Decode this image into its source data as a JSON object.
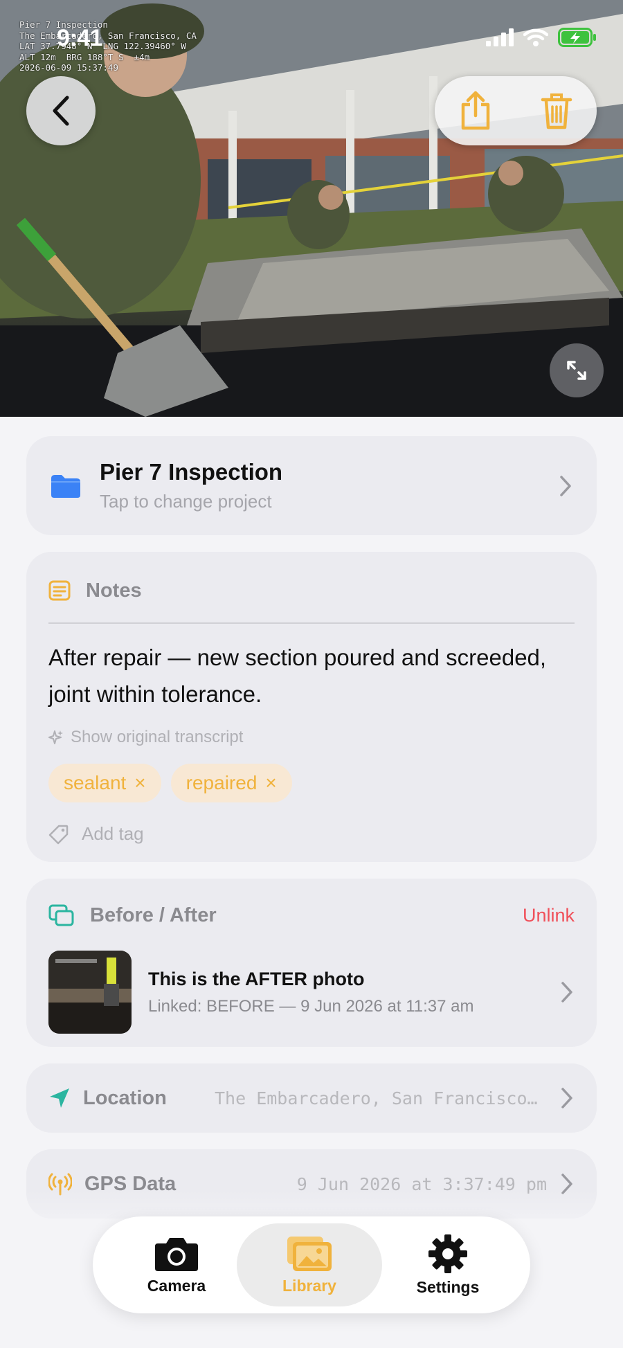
{
  "status_bar": {
    "time": "9:41"
  },
  "photo": {
    "overlay_lines": [
      "Pier 7 Inspection",
      "The Embarcadero, San Francisco, CA",
      "LAT 37.7948° N  LNG 122.39460° W",
      "ALT 12m  BRG 188°T S  ±4m",
      "2026-06-09 15:37:49"
    ]
  },
  "project": {
    "title": "Pier 7 Inspection",
    "subtitle": "Tap to change project"
  },
  "notes": {
    "label": "Notes",
    "body": "After repair — new section poured and screeded, joint within tolerance.",
    "transcript_link": "Show original transcript",
    "tags": [
      {
        "label": "sealant",
        "remove": "×"
      },
      {
        "label": "repaired",
        "remove": "×"
      }
    ],
    "add_tag": "Add tag"
  },
  "before_after": {
    "label": "Before / After",
    "unlink": "Unlink",
    "title": "This is the AFTER photo",
    "subtitle": "Linked: BEFORE — 9 Jun 2026 at 11:37 am"
  },
  "location": {
    "label": "Location",
    "value": "The Embarcadero, San Francisco, CA"
  },
  "gps": {
    "label": "GPS Data",
    "value": "9 Jun 2026 at 3:37:49 pm"
  },
  "tabbar": {
    "items": [
      {
        "label": "Camera",
        "icon": "camera-icon"
      },
      {
        "label": "Library",
        "icon": "photos-icon",
        "active": true
      },
      {
        "label": "Settings",
        "icon": "gear-icon"
      }
    ]
  },
  "colors": {
    "accent": "#f0b23c",
    "destructive": "#f0505a",
    "folder": "#3b82f6",
    "location": "#2bb5a0"
  }
}
